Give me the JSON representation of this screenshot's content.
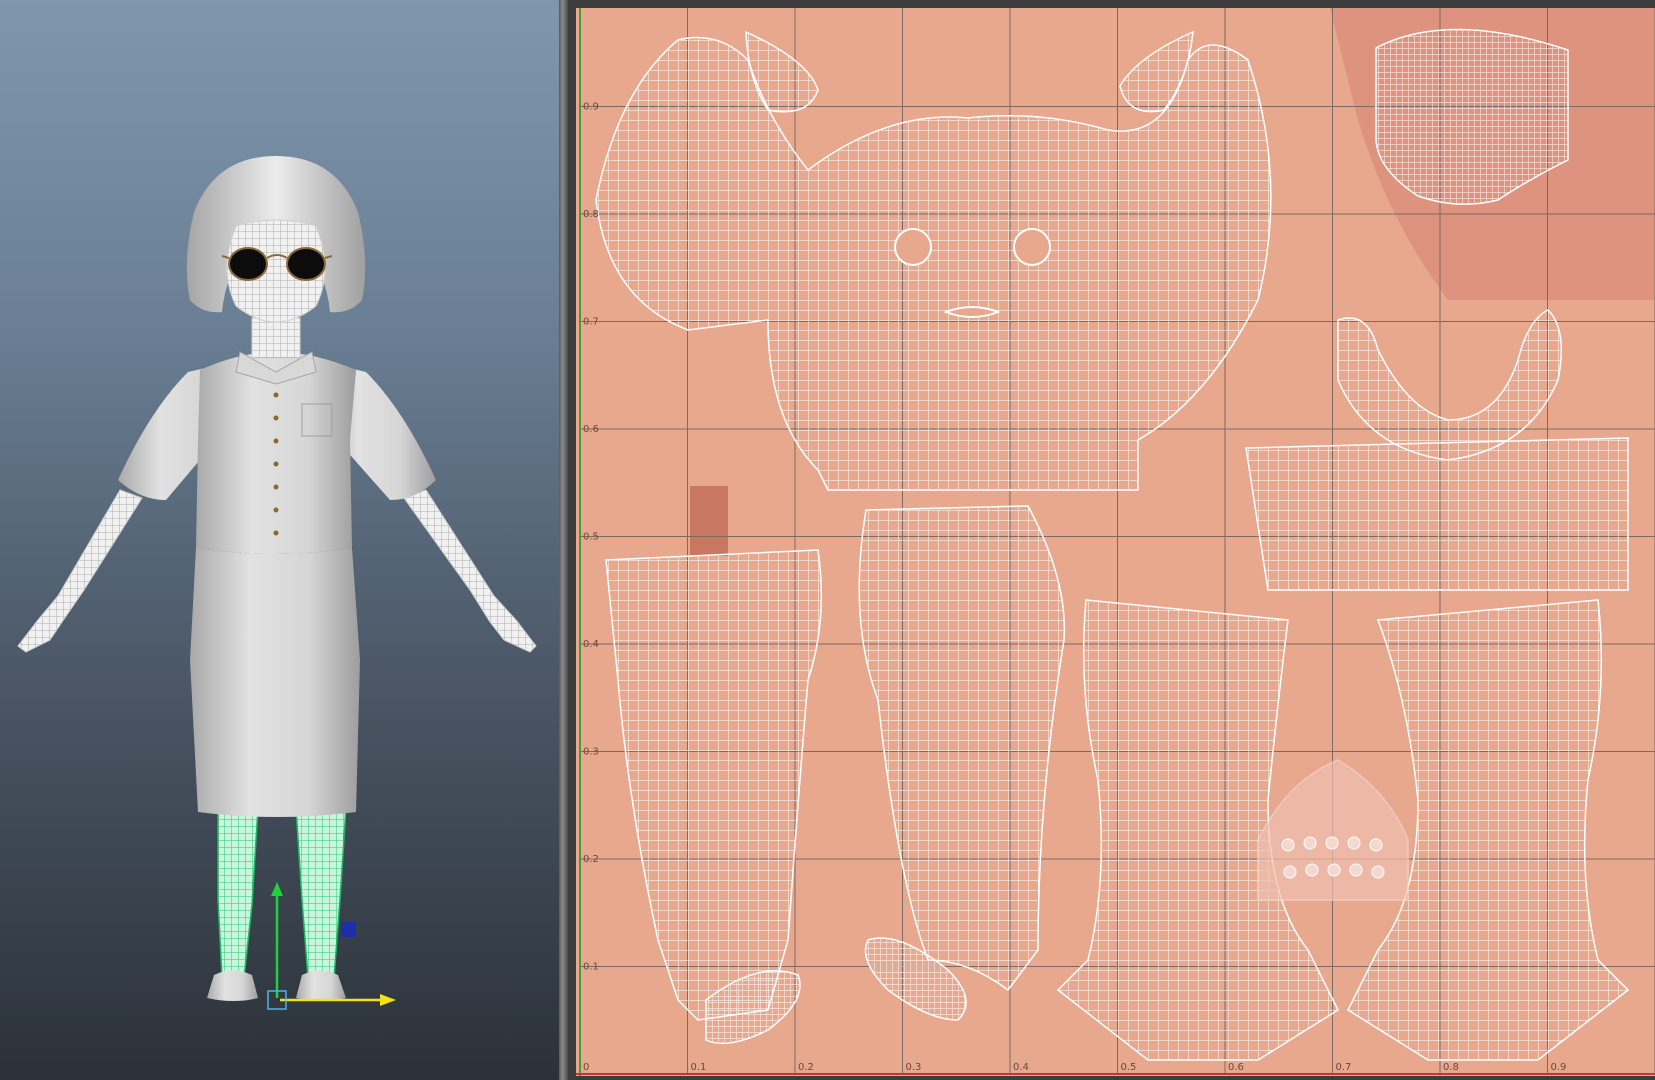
{
  "viewport": {
    "character": "character-mesh",
    "manipulator": {
      "y_axis_color": "#1fd13a",
      "x_axis_color": "#f3e21a",
      "z_handle_color": "#1c2ea8"
    }
  },
  "uv_editor": {
    "texture_color": "#e8a88e",
    "grid_lines": "#7d6a63",
    "wire_color": "#ffffff",
    "v_ticks": [
      "0.9",
      "0.8",
      "0.7",
      "0.6",
      "0.5",
      "0.4",
      "0.3",
      "0.2",
      "0.1"
    ],
    "u_ticks": [
      "0",
      "0.1",
      "0.2",
      "0.3",
      "0.4",
      "0.5",
      "0.6",
      "0.7",
      "0.8",
      "0.9"
    ],
    "axis_v_color": "#3f9c3f",
    "axis_u_color": "#c83232"
  }
}
